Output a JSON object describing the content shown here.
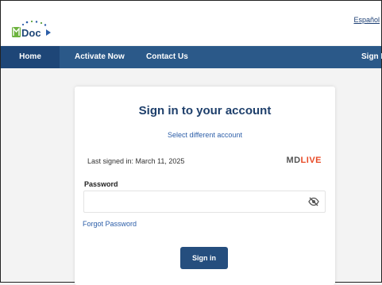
{
  "header": {
    "logo_text": "Doc",
    "language_link": "Español"
  },
  "nav": {
    "items": [
      {
        "label": "Home",
        "active": true
      },
      {
        "label": "Activate Now"
      },
      {
        "label": "Contact Us"
      },
      {
        "label": "Sign In"
      }
    ]
  },
  "signin": {
    "title": "Sign in to your account",
    "select_account": "Select different account",
    "last_signed": "Last signed in: March 11, 2025",
    "provider_logo_md": "MD",
    "provider_logo_live": "LIVE",
    "password_label": "Password",
    "password_value": "",
    "password_placeholder": "",
    "eye_icon": "eye-slash-icon",
    "forgot_link": "Forgot Password",
    "signin_button": "Sign in"
  },
  "colors": {
    "nav_bg": "#2b5989",
    "nav_active": "#1e4677",
    "title": "#1e3f6b",
    "link": "#2c5ea8",
    "button": "#254e7e",
    "live_accent": "#e84a26"
  }
}
